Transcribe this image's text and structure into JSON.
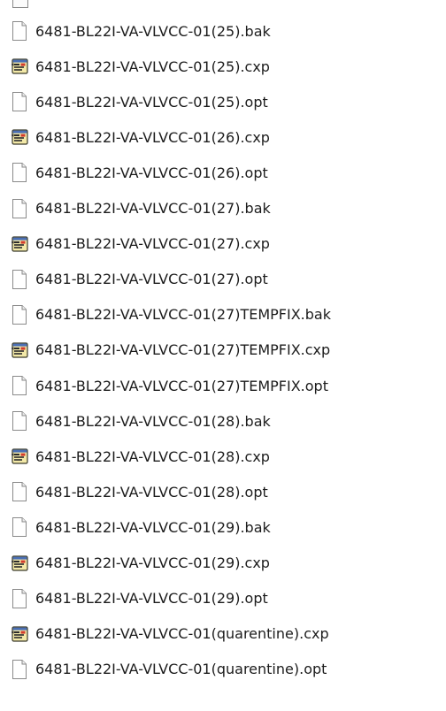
{
  "files": [
    {
      "name": "6481-BL22I-VA-VLVCC-01(25).bak",
      "icon": "document-icon"
    },
    {
      "name": "6481-BL22I-VA-VLVCC-01(25).cxp",
      "icon": "application-file-icon"
    },
    {
      "name": "6481-BL22I-VA-VLVCC-01(25).opt",
      "icon": "document-icon"
    },
    {
      "name": "6481-BL22I-VA-VLVCC-01(26).cxp",
      "icon": "application-file-icon"
    },
    {
      "name": "6481-BL22I-VA-VLVCC-01(26).opt",
      "icon": "document-icon"
    },
    {
      "name": "6481-BL22I-VA-VLVCC-01(27).bak",
      "icon": "document-icon"
    },
    {
      "name": "6481-BL22I-VA-VLVCC-01(27).cxp",
      "icon": "application-file-icon"
    },
    {
      "name": "6481-BL22I-VA-VLVCC-01(27).opt",
      "icon": "document-icon"
    },
    {
      "name": "6481-BL22I-VA-VLVCC-01(27)TEMPFIX.bak",
      "icon": "document-icon"
    },
    {
      "name": "6481-BL22I-VA-VLVCC-01(27)TEMPFIX.cxp",
      "icon": "application-file-icon"
    },
    {
      "name": "6481-BL22I-VA-VLVCC-01(27)TEMPFIX.opt",
      "icon": "document-icon"
    },
    {
      "name": "6481-BL22I-VA-VLVCC-01(28).bak",
      "icon": "document-icon"
    },
    {
      "name": "6481-BL22I-VA-VLVCC-01(28).cxp",
      "icon": "application-file-icon"
    },
    {
      "name": "6481-BL22I-VA-VLVCC-01(28).opt",
      "icon": "document-icon"
    },
    {
      "name": "6481-BL22I-VA-VLVCC-01(29).bak",
      "icon": "document-icon"
    },
    {
      "name": "6481-BL22I-VA-VLVCC-01(29).cxp",
      "icon": "application-file-icon"
    },
    {
      "name": "6481-BL22I-VA-VLVCC-01(29).opt",
      "icon": "document-icon"
    },
    {
      "name": "6481-BL22I-VA-VLVCC-01(quarentine).cxp",
      "icon": "application-file-icon"
    },
    {
      "name": "6481-BL22I-VA-VLVCC-01(quarentine).opt",
      "icon": "document-icon"
    }
  ],
  "colors": {
    "text": "#1c1c1c",
    "row_hover": "#e5f3fb",
    "doc_border": "#8a8a8a"
  }
}
